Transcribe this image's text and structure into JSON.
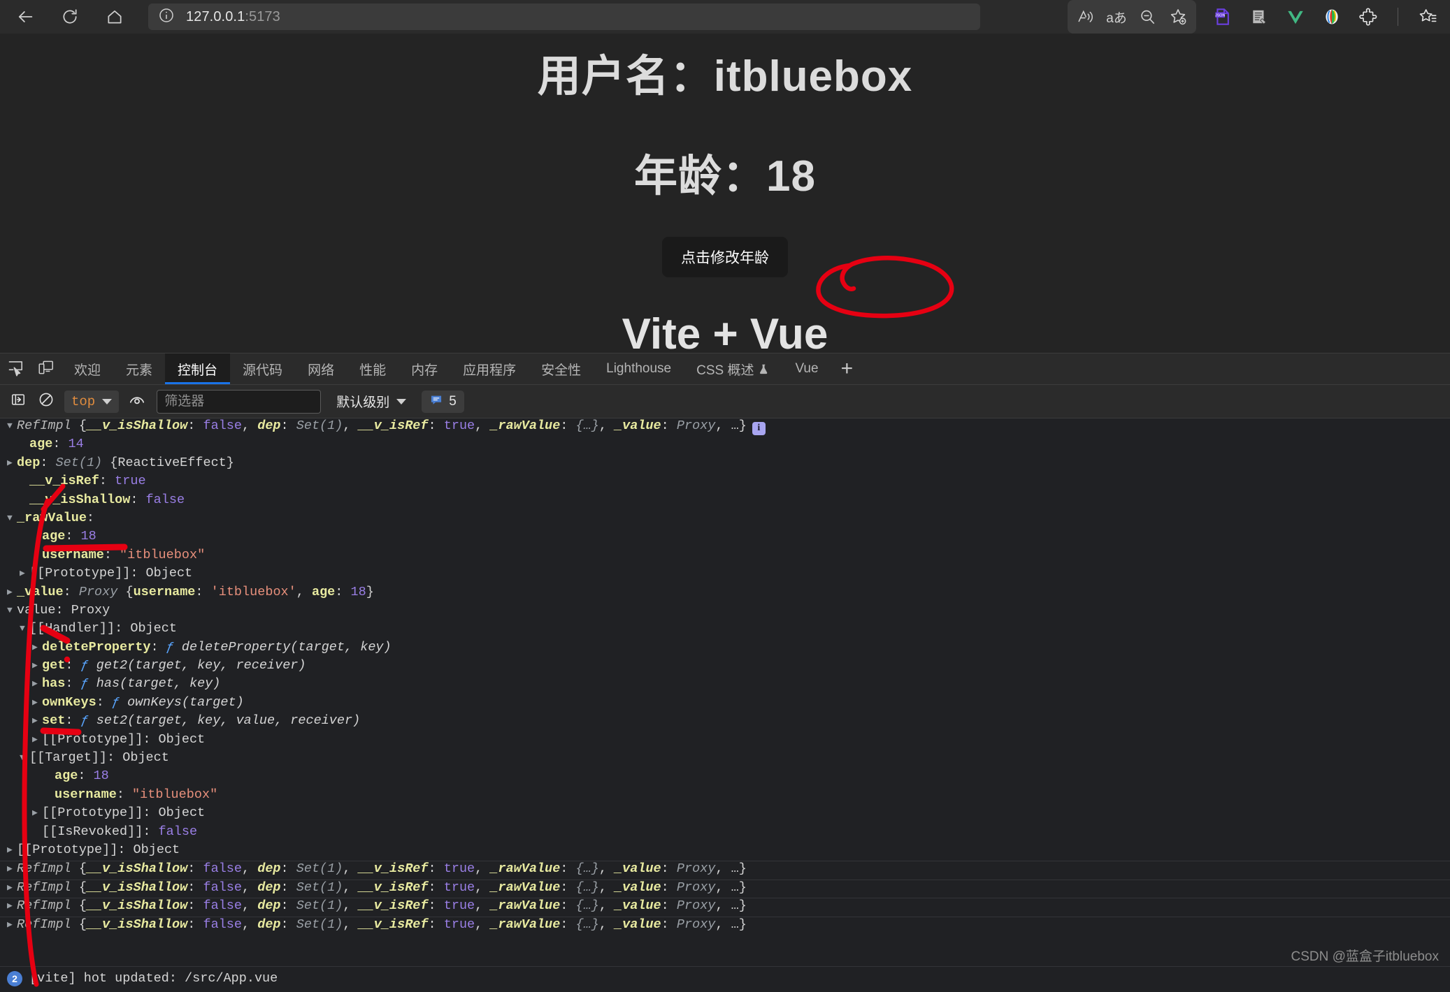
{
  "browser": {
    "nav": {
      "back_icon": "arrow-left-icon",
      "reload_icon": "reload-icon",
      "home_icon": "home-icon"
    },
    "address": {
      "info_icon": "site-info-icon",
      "host": "127.0.0.1",
      "port": ":5173"
    },
    "right_actions": [
      {
        "name": "read-aloud-icon",
        "glyph": "A))"
      },
      {
        "name": "translate-icon",
        "glyph": "aあ"
      },
      {
        "name": "zoom-out-icon",
        "glyph": "minus-magnifier"
      },
      {
        "name": "add-favorite-icon",
        "glyph": "star-plus"
      }
    ],
    "extensions": [
      {
        "name": "json-viewer-extension-icon",
        "label": "JSON",
        "color": "#6b3fe0"
      },
      {
        "name": "page-tools-extension-icon",
        "color": "#b9b9b9"
      },
      {
        "name": "vue-devtools-extension-icon",
        "color": "#41b883"
      },
      {
        "name": "color-picker-extension-icon",
        "color": "#e8e8e8"
      },
      {
        "name": "extensions-puzzle-icon",
        "color": "#e8e8e8"
      },
      {
        "name": "collections-icon",
        "color": "#e8e8e8"
      }
    ]
  },
  "page": {
    "username_label": "用户名：",
    "username_value": "itbluebox",
    "age_label": "年龄：",
    "age_value": "18",
    "button_label": "点击修改年龄",
    "title": "Vite + Vue",
    "annotation_color": "#e60012",
    "bg_color": "#242424"
  },
  "devtools": {
    "left_icons": [
      {
        "name": "inspect-element-icon"
      },
      {
        "name": "device-toolbar-icon"
      }
    ],
    "tabs": [
      {
        "label": "欢迎",
        "active": false
      },
      {
        "label": "元素",
        "active": false
      },
      {
        "label": "控制台",
        "active": true
      },
      {
        "label": "源代码",
        "active": false
      },
      {
        "label": "网络",
        "active": false
      },
      {
        "label": "性能",
        "active": false
      },
      {
        "label": "内存",
        "active": false
      },
      {
        "label": "应用程序",
        "active": false
      },
      {
        "label": "安全性",
        "active": false
      },
      {
        "label": "Lighthouse",
        "active": false
      },
      {
        "label": "CSS 概述",
        "active": false,
        "icon": "flask-icon"
      },
      {
        "label": "Vue",
        "active": false
      }
    ],
    "add_tab_label": "+",
    "active_tab_accent": "#1a73e8"
  },
  "console_toolbar": {
    "sidebar_toggle_icon": "console-sidebar-toggle-icon",
    "clear_console_icon": "clear-console-icon",
    "context_label": "top",
    "eye_icon": "live-expression-icon",
    "filter_placeholder": "筛选器",
    "filter_value": "",
    "level_label": "默认级别",
    "message_badge_icon": "message-bubble-icon",
    "message_count": "5"
  },
  "console": {
    "header": {
      "class_name": "RefImpl",
      "summary_parts": [
        {
          "t": " {",
          "c": "punct"
        },
        {
          "t": "__v_isShallow",
          "c": "k-propi"
        },
        {
          "t": ": ",
          "c": "punct"
        },
        {
          "t": "false",
          "c": "v-bool"
        },
        {
          "t": ", ",
          "c": "punct"
        },
        {
          "t": "dep",
          "c": "k-propi"
        },
        {
          "t": ": ",
          "c": "punct"
        },
        {
          "t": "Set(1)",
          "c": "v-gray"
        },
        {
          "t": ", ",
          "c": "punct"
        },
        {
          "t": "__v_isRef",
          "c": "k-propi"
        },
        {
          "t": ": ",
          "c": "punct"
        },
        {
          "t": "true",
          "c": "v-bool"
        },
        {
          "t": ", ",
          "c": "punct"
        },
        {
          "t": "_rawValue",
          "c": "k-propi"
        },
        {
          "t": ": ",
          "c": "punct"
        },
        {
          "t": "{…}",
          "c": "v-gray"
        },
        {
          "t": ", ",
          "c": "punct"
        },
        {
          "t": "_value",
          "c": "k-propi"
        },
        {
          "t": ": ",
          "c": "punct"
        },
        {
          "t": "Proxy",
          "c": "v-gray"
        },
        {
          "t": ", …}",
          "c": "punct"
        }
      ],
      "info_badge": "i"
    },
    "rows": [
      {
        "indent": 1,
        "arrow": "none",
        "parts": [
          {
            "t": "age",
            "c": "k-prop"
          },
          {
            "t": ": ",
            "c": "punct"
          },
          {
            "t": "14",
            "c": "v-num"
          }
        ]
      },
      {
        "indent": 0,
        "arrow": "right",
        "parts": [
          {
            "t": "dep",
            "c": "k-prop"
          },
          {
            "t": ": ",
            "c": "punct"
          },
          {
            "t": "Set(1) ",
            "c": "v-gray"
          },
          {
            "t": "{ReactiveEffect}",
            "c": "v-plain"
          }
        ]
      },
      {
        "indent": 1,
        "arrow": "none",
        "parts": [
          {
            "t": "__v_isRef",
            "c": "k-prop"
          },
          {
            "t": ": ",
            "c": "punct"
          },
          {
            "t": "true",
            "c": "v-bool"
          }
        ]
      },
      {
        "indent": 1,
        "arrow": "none",
        "parts": [
          {
            "t": "__v_isShallow",
            "c": "k-prop"
          },
          {
            "t": ": ",
            "c": "punct"
          },
          {
            "t": "false",
            "c": "v-bool"
          }
        ]
      },
      {
        "indent": 0,
        "arrow": "down",
        "parts": [
          {
            "t": "_rawValue",
            "c": "k-prop"
          },
          {
            "t": ":",
            "c": "punct"
          }
        ]
      },
      {
        "indent": 2,
        "arrow": "none",
        "parts": [
          {
            "t": "age",
            "c": "k-prop"
          },
          {
            "t": ": ",
            "c": "punct"
          },
          {
            "t": "18",
            "c": "v-num"
          }
        ]
      },
      {
        "indent": 2,
        "arrow": "none",
        "parts": [
          {
            "t": "username",
            "c": "k-prop"
          },
          {
            "t": ": ",
            "c": "punct"
          },
          {
            "t": "\"itbluebox\"",
            "c": "v-str"
          }
        ]
      },
      {
        "indent": 1,
        "arrow": "right",
        "parts": [
          {
            "t": "[[Prototype]]",
            "c": "v-internal"
          },
          {
            "t": ": ",
            "c": "punct"
          },
          {
            "t": "Object",
            "c": "v-plain"
          }
        ]
      },
      {
        "indent": 0,
        "arrow": "right",
        "parts": [
          {
            "t": "_value",
            "c": "k-prop"
          },
          {
            "t": ": ",
            "c": "punct"
          },
          {
            "t": "Proxy ",
            "c": "v-gray"
          },
          {
            "t": "{",
            "c": "punct"
          },
          {
            "t": "username",
            "c": "k-prop"
          },
          {
            "t": ": ",
            "c": "punct"
          },
          {
            "t": "'itbluebox'",
            "c": "v-str"
          },
          {
            "t": ", ",
            "c": "punct"
          },
          {
            "t": "age",
            "c": "k-prop"
          },
          {
            "t": ": ",
            "c": "punct"
          },
          {
            "t": "18",
            "c": "v-num"
          },
          {
            "t": "}",
            "c": "punct"
          }
        ]
      },
      {
        "indent": 0,
        "arrow": "down",
        "parts": [
          {
            "t": "value",
            "c": "v-plain"
          },
          {
            "t": ": ",
            "c": "punct"
          },
          {
            "t": "Proxy",
            "c": "v-plain"
          }
        ]
      },
      {
        "indent": 1,
        "arrow": "down",
        "parts": [
          {
            "t": "[[Handler]]",
            "c": "v-internal"
          },
          {
            "t": ": ",
            "c": "punct"
          },
          {
            "t": "Object",
            "c": "v-plain"
          }
        ]
      },
      {
        "indent": 2,
        "arrow": "right",
        "parts": [
          {
            "t": "deleteProperty",
            "c": "k-prop"
          },
          {
            "t": ": ",
            "c": "punct"
          },
          {
            "t": "ƒ ",
            "c": "v-fn"
          },
          {
            "t": "deleteProperty(target, key)",
            "c": "v-fnname"
          }
        ]
      },
      {
        "indent": 2,
        "arrow": "right",
        "parts": [
          {
            "t": "get",
            "c": "k-prop"
          },
          {
            "t": ": ",
            "c": "punct"
          },
          {
            "t": "ƒ ",
            "c": "v-fn"
          },
          {
            "t": "get2(target, key, receiver)",
            "c": "v-fnname"
          }
        ]
      },
      {
        "indent": 2,
        "arrow": "right",
        "parts": [
          {
            "t": "has",
            "c": "k-prop"
          },
          {
            "t": ": ",
            "c": "punct"
          },
          {
            "t": "ƒ ",
            "c": "v-fn"
          },
          {
            "t": "has(target, key)",
            "c": "v-fnname"
          }
        ]
      },
      {
        "indent": 2,
        "arrow": "right",
        "parts": [
          {
            "t": "ownKeys",
            "c": "k-prop"
          },
          {
            "t": ": ",
            "c": "punct"
          },
          {
            "t": "ƒ ",
            "c": "v-fn"
          },
          {
            "t": "ownKeys(target)",
            "c": "v-fnname"
          }
        ]
      },
      {
        "indent": 2,
        "arrow": "right",
        "parts": [
          {
            "t": "set",
            "c": "k-prop"
          },
          {
            "t": ": ",
            "c": "punct"
          },
          {
            "t": "ƒ ",
            "c": "v-fn"
          },
          {
            "t": "set2(target, key, value, receiver)",
            "c": "v-fnname"
          }
        ]
      },
      {
        "indent": 2,
        "arrow": "right",
        "parts": [
          {
            "t": "[[Prototype]]",
            "c": "v-internal"
          },
          {
            "t": ": ",
            "c": "punct"
          },
          {
            "t": "Object",
            "c": "v-plain"
          }
        ]
      },
      {
        "indent": 1,
        "arrow": "down",
        "parts": [
          {
            "t": "[[Target]]",
            "c": "v-internal"
          },
          {
            "t": ": ",
            "c": "punct"
          },
          {
            "t": "Object",
            "c": "v-plain"
          }
        ]
      },
      {
        "indent": 3,
        "arrow": "none",
        "parts": [
          {
            "t": "age",
            "c": "k-prop"
          },
          {
            "t": ": ",
            "c": "punct"
          },
          {
            "t": "18",
            "c": "v-num"
          }
        ]
      },
      {
        "indent": 3,
        "arrow": "none",
        "parts": [
          {
            "t": "username",
            "c": "k-prop"
          },
          {
            "t": ": ",
            "c": "punct"
          },
          {
            "t": "\"itbluebox\"",
            "c": "v-str"
          }
        ]
      },
      {
        "indent": 2,
        "arrow": "right",
        "parts": [
          {
            "t": "[[Prototype]]",
            "c": "v-internal"
          },
          {
            "t": ": ",
            "c": "punct"
          },
          {
            "t": "Object",
            "c": "v-plain"
          }
        ]
      },
      {
        "indent": 2,
        "arrow": "none",
        "parts": [
          {
            "t": "[[IsRevoked]]",
            "c": "v-internal"
          },
          {
            "t": ": ",
            "c": "punct"
          },
          {
            "t": "false",
            "c": "v-bool"
          }
        ]
      },
      {
        "indent": 0,
        "arrow": "right",
        "parts": [
          {
            "t": "[[Prototype]]",
            "c": "v-internal"
          },
          {
            "t": ": ",
            "c": "punct"
          },
          {
            "t": "Object",
            "c": "v-plain"
          }
        ]
      }
    ],
    "collapsed_refimpl_count": 4,
    "vite_message": {
      "count": "2",
      "text": "[vite] hot updated: /src/App.vue"
    }
  },
  "watermark": "CSDN @蓝盒子itbluebox"
}
